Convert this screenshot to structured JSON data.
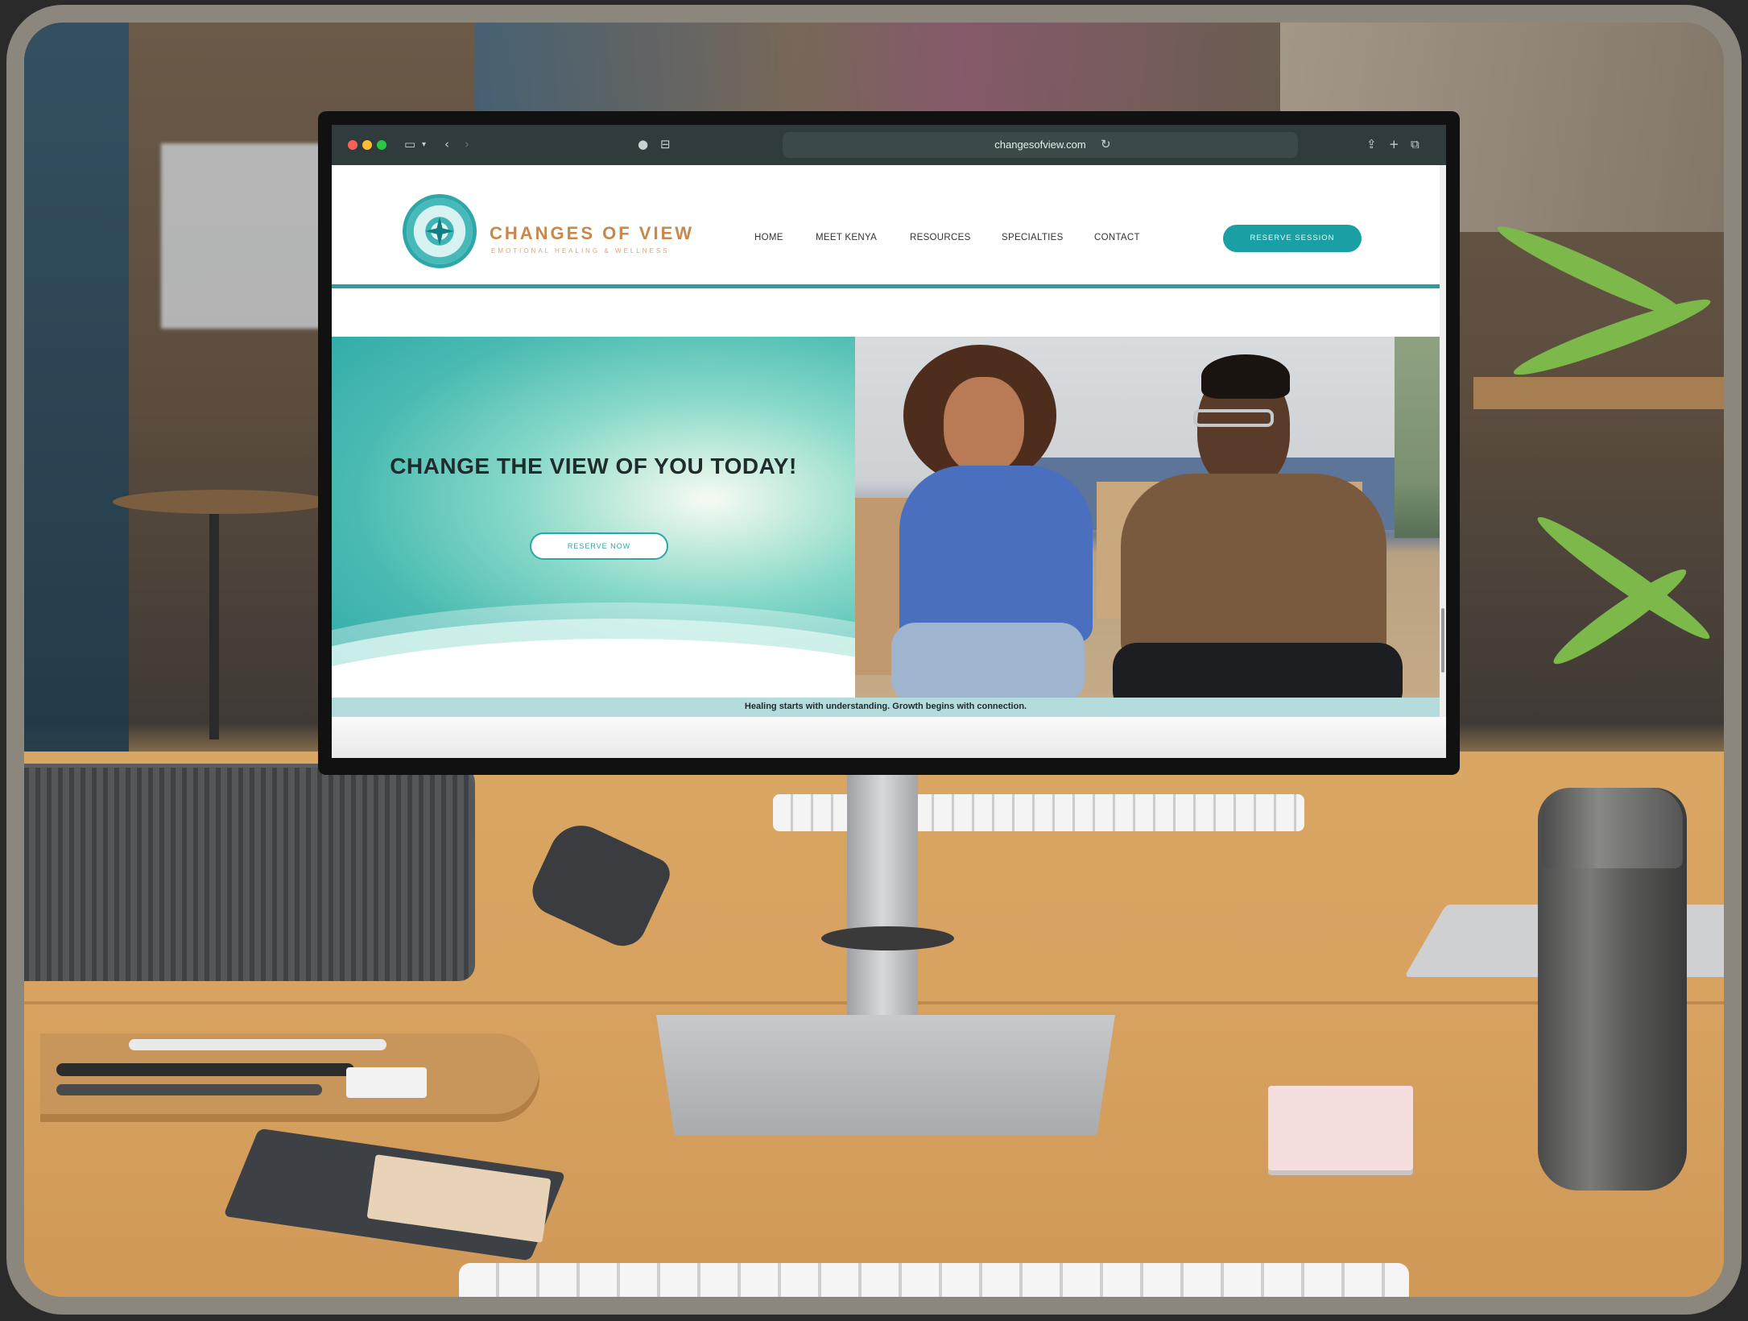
{
  "browser": {
    "url": "changesofview.com"
  },
  "site": {
    "brand_name": "CHANGES OF VIEW",
    "brand_tagline": "EMOTIONAL HEALING & WELLNESS",
    "nav": [
      {
        "label": "HOME"
      },
      {
        "label": "MEET KENYA"
      },
      {
        "label": "RESOURCES"
      },
      {
        "label": "SPECIALTIES"
      },
      {
        "label": "CONTACT"
      }
    ],
    "cta_label": "RESERVE SESSION"
  },
  "hero": {
    "title": "CHANGE THE VIEW OF YOU TODAY!",
    "button_label": "RESERVE NOW"
  },
  "tagline": "Healing starts with understanding. Growth begins with connection.",
  "colors": {
    "brand_teal": "#1aa0a4",
    "brand_copper": "#c8874b",
    "tagline_bar": "#b5dcdd"
  }
}
